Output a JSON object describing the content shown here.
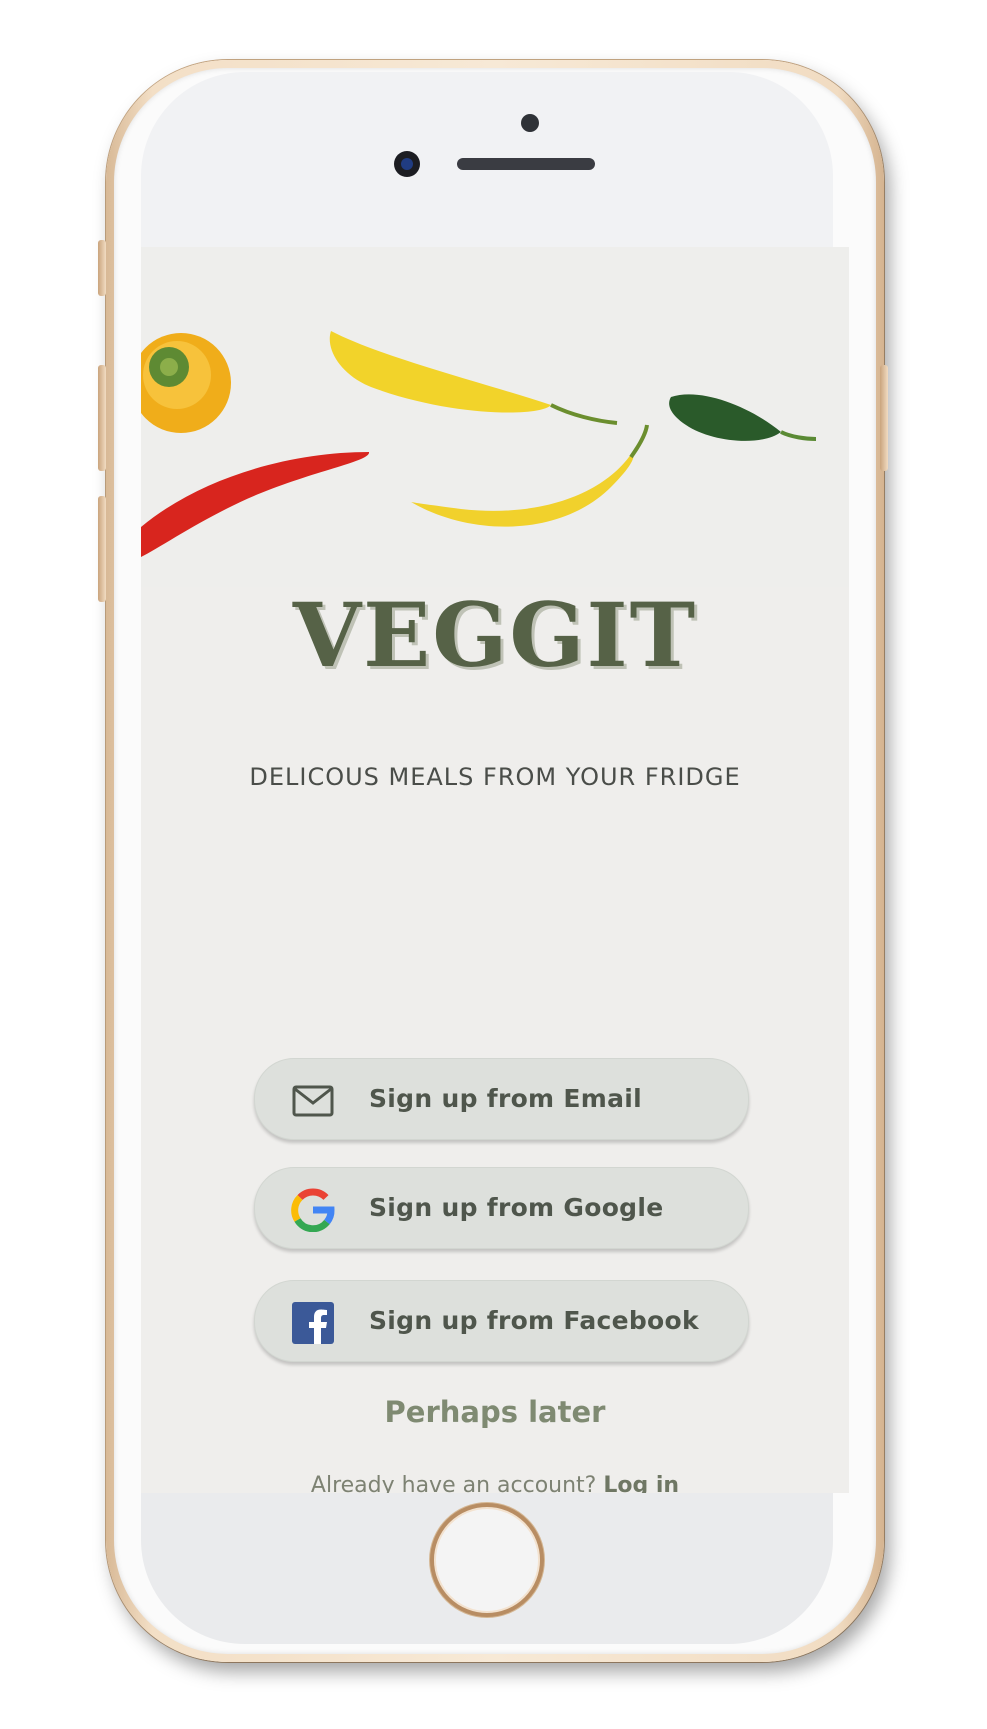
{
  "app": {
    "title": "VEGGIT",
    "tagline": "DELICOUS MEALS FROM YOUR FRIDGE"
  },
  "signup": {
    "email_label": "Sign up from Email",
    "google_label": "Sign up from Google",
    "facebook_label": "Sign up from Facebook"
  },
  "skip_label": "Perhaps later",
  "login": {
    "prompt": "Already have an account?",
    "link_label": "Log in"
  },
  "icons": {
    "email": "envelope-icon",
    "google": "google-logo-icon",
    "facebook": "facebook-logo-icon"
  },
  "colors": {
    "brand": "#566247",
    "button_bg": "#dde0dc",
    "button_text": "#4f564c",
    "accent_text": "#7f8a72",
    "screen_bg": "#efeeec"
  }
}
